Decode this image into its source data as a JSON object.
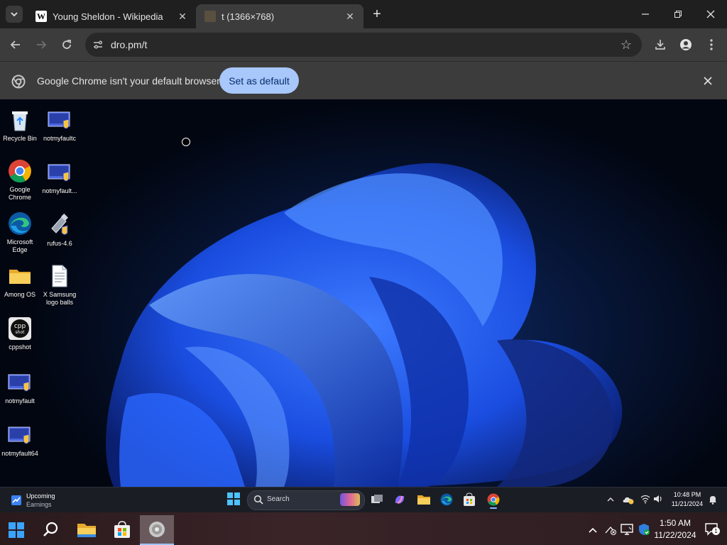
{
  "tabs": [
    {
      "title": "Young Sheldon - Wikipedia",
      "favicon": "W"
    },
    {
      "title": "t (1366×768)",
      "favicon": "image"
    }
  ],
  "address": {
    "url": "dro.pm/t"
  },
  "infobar": {
    "message": "Google Chrome isn't your default browser",
    "button": "Set as default"
  },
  "desktop_icons": [
    {
      "label": "Recycle Bin",
      "icon": "recycle-bin"
    },
    {
      "label": "notmyfaultc",
      "icon": "app-shield"
    },
    {
      "label": "Google Chrome",
      "icon": "chrome"
    },
    {
      "label": "notmyfault...",
      "icon": "app-shield"
    },
    {
      "label": "Microsoft Edge",
      "icon": "edge"
    },
    {
      "label": "rufus-4.6",
      "icon": "usb-shield"
    },
    {
      "label": "Among OS",
      "icon": "folder"
    },
    {
      "label": "X Samsung logo balls",
      "icon": "document"
    },
    {
      "label": "cppshot",
      "icon": "cppshot"
    },
    {
      "label": "notmyfault",
      "icon": "app-shield"
    },
    {
      "label": "notmyfault64",
      "icon": "app-shield"
    }
  ],
  "inner_taskbar": {
    "widget_title": "Upcoming",
    "widget_sub": "Earnings",
    "search_placeholder": "Search",
    "time": "10:48 PM",
    "date": "11/21/2024"
  },
  "outer_taskbar": {
    "time": "1:50 AM",
    "date": "11/22/2024",
    "notification_count": "1"
  },
  "colors": {
    "accent": "#a8c7fa",
    "desktop_blue": "#1e5cff"
  }
}
